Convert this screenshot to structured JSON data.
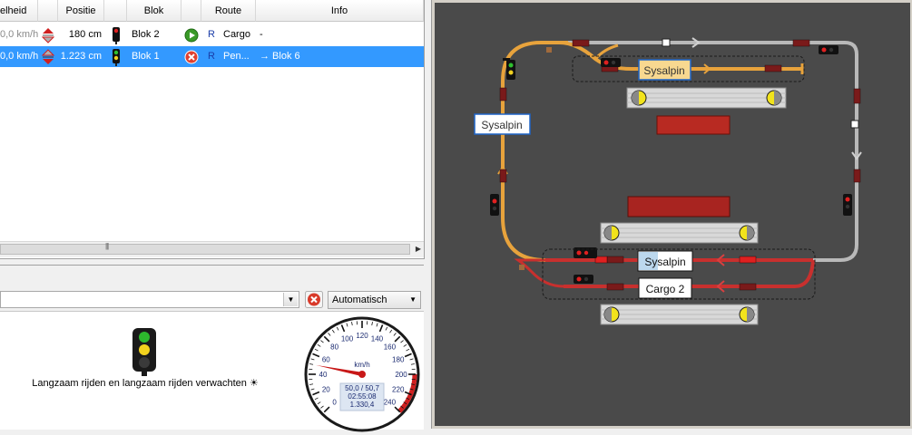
{
  "train_table": {
    "headers": [
      "elheid",
      "Positie",
      "Blok",
      "Route",
      "Info"
    ],
    "rows": [
      {
        "speed": "0,0 km/h",
        "position": "180 cm",
        "block": "Blok 2",
        "route_type": "R",
        "route": "Cargo",
        "info": "-",
        "selected": false,
        "signal_state": "red",
        "route_state": "play"
      },
      {
        "speed": "0,0 km/h",
        "position": "1.223 cm",
        "block": "Blok 1",
        "route_type": "R",
        "route": "Pen...",
        "info": "→ Blok 6",
        "selected": true,
        "signal_state": "green-yellow",
        "route_state": "cancel"
      }
    ],
    "scroll_grip": "|||"
  },
  "driver": {
    "train_value": "",
    "mode": "Automatisch",
    "signal_text": "Langzaam rijden en langzaam rijden verwachten ☀",
    "speedometer": {
      "unit": "km/h",
      "ticks": [
        "0",
        "20",
        "40",
        "60",
        "80",
        "100",
        "120",
        "140",
        "160",
        "180",
        "200",
        "220",
        "240"
      ],
      "needle_value": 50,
      "max": 240,
      "readout_speed": "50,0 / 50,7",
      "readout_time": "02:55:08",
      "readout_distance": "1.330,4"
    }
  },
  "layout": {
    "labels": {
      "sysalpin_top": "Sysalpin",
      "sysalpin_left": "Sysalpin",
      "sysalpin_bottom": "Sysalpin",
      "cargo_bottom": "Cargo 2"
    },
    "colors": {
      "background": "#4a4a4a",
      "reserved_route": "#e8a33c",
      "occupied_route": "#c8302e",
      "free_track": "#b9b9b9",
      "block_marker": "#7a1a1a",
      "label_border": "#1e64c8"
    }
  }
}
